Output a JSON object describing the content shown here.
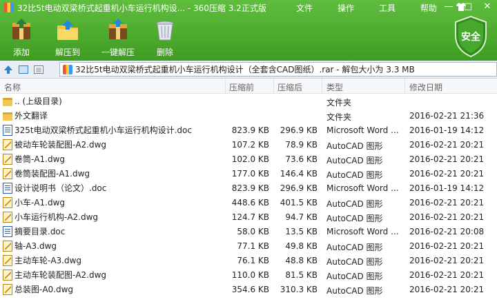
{
  "titlebar": {
    "title": "32比5t电动双梁桥式起重机小车运行机构设... - 360压缩 3.2正式版",
    "menus": [
      "文件",
      "操作",
      "工具",
      "帮助"
    ],
    "window_buttons": [
      "—",
      "□",
      "✕"
    ]
  },
  "toolbar": {
    "buttons": [
      {
        "label": "添加",
        "icon": "add-archive-icon"
      },
      {
        "label": "解压到",
        "icon": "extract-to-icon"
      },
      {
        "label": "一键解压",
        "icon": "one-click-extract-icon"
      },
      {
        "label": "删除",
        "icon": "trash-icon"
      }
    ],
    "security_badge": "安全"
  },
  "address": {
    "path": "32比5t电动双梁桥式起重机小车运行机构设计（全套含CAD图纸）.rar - 解包大小为 3.3 MB"
  },
  "columns": {
    "name": "名称",
    "size": "压缩前",
    "compressed": "压缩后",
    "type": "类型",
    "date": "修改日期"
  },
  "files": [
    {
      "icon": "folder",
      "name": ".. (上级目录)",
      "size": "",
      "compressed": "",
      "type": "文件夹",
      "date": ""
    },
    {
      "icon": "folder",
      "name": "外文翻译",
      "size": "",
      "compressed": "",
      "type": "文件夹",
      "date": "2016-02-21 21:36"
    },
    {
      "icon": "doc",
      "name": "325t电动双梁桥式起重机小车运行机构设计.doc",
      "size": "823.9 KB",
      "compressed": "296.9 KB",
      "type": "Microsoft Word ...",
      "date": "2016-01-19 14:12"
    },
    {
      "icon": "dwg",
      "name": "被动车轮装配图-A2.dwg",
      "size": "107.2 KB",
      "compressed": "78.9 KB",
      "type": "AutoCAD 图形",
      "date": "2016-02-21 20:21"
    },
    {
      "icon": "dwg",
      "name": "卷筒-A1.dwg",
      "size": "102.0 KB",
      "compressed": "73.6 KB",
      "type": "AutoCAD 图形",
      "date": "2016-02-21 20:21"
    },
    {
      "icon": "dwg",
      "name": "卷筒装配图-A1.dwg",
      "size": "177.0 KB",
      "compressed": "146.4 KB",
      "type": "AutoCAD 图形",
      "date": "2016-02-21 20:21"
    },
    {
      "icon": "doc",
      "name": "设计说明书（论文）.doc",
      "size": "823.9 KB",
      "compressed": "296.9 KB",
      "type": "Microsoft Word ...",
      "date": "2016-01-19 14:12"
    },
    {
      "icon": "dwg",
      "name": "小车-A1.dwg",
      "size": "448.6 KB",
      "compressed": "401.5 KB",
      "type": "AutoCAD 图形",
      "date": "2016-02-21 20:21"
    },
    {
      "icon": "dwg",
      "name": "小车运行机构-A2.dwg",
      "size": "124.7 KB",
      "compressed": "94.7 KB",
      "type": "AutoCAD 图形",
      "date": "2016-02-21 20:21"
    },
    {
      "icon": "doc",
      "name": "摘要目录.doc",
      "size": "58.0 KB",
      "compressed": "13.5 KB",
      "type": "Microsoft Word ...",
      "date": "2016-02-21 20:08"
    },
    {
      "icon": "dwg",
      "name": "轴-A3.dwg",
      "size": "77.1 KB",
      "compressed": "49.8 KB",
      "type": "AutoCAD 图形",
      "date": "2016-02-21 20:21"
    },
    {
      "icon": "dwg",
      "name": "主动车轮-A3.dwg",
      "size": "76.1 KB",
      "compressed": "48.8 KB",
      "type": "AutoCAD 图形",
      "date": "2016-02-21 20:21"
    },
    {
      "icon": "dwg",
      "name": "主动车轮装配图-A2.dwg",
      "size": "110.0 KB",
      "compressed": "81.5 KB",
      "type": "AutoCAD 图形",
      "date": "2016-02-21 20:21"
    },
    {
      "icon": "dwg",
      "name": "总装图-A0.dwg",
      "size": "354.6 KB",
      "compressed": "310.3 KB",
      "type": "AutoCAD 图形",
      "date": "2016-02-21 20:21"
    }
  ]
}
